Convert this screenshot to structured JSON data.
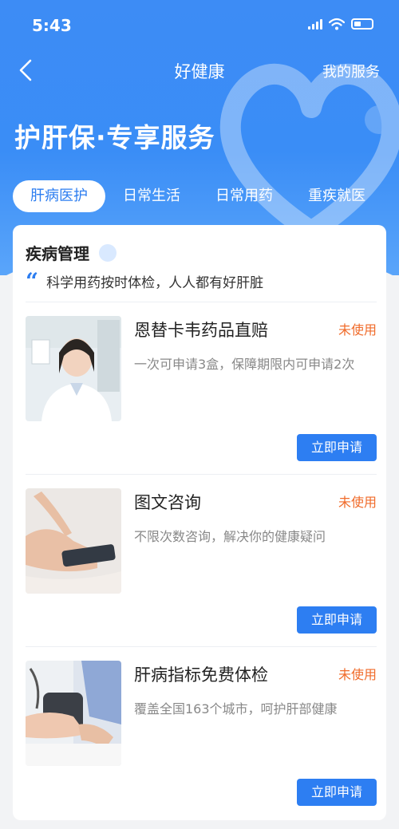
{
  "status_bar": {
    "time": "5:43"
  },
  "nav": {
    "title": "好健康",
    "right_link": "我的服务",
    "back_icon": "chevron-left-icon"
  },
  "hero": {
    "heading": "护肝保·专享服务"
  },
  "tabs": [
    {
      "label": "肝病医护",
      "active": true
    },
    {
      "label": "日常生活",
      "active": false
    },
    {
      "label": "日常用药",
      "active": false
    },
    {
      "label": "重疾就医",
      "active": false
    }
  ],
  "section": {
    "title": "疾病管理",
    "quote": "科学用药按时体检，人人都有好肝脏",
    "quote_icon": "quote-icon"
  },
  "items": [
    {
      "title": "恩替卡韦药品直赔",
      "status": "未使用",
      "desc": "一次可申请3盒，保障期限内可申请2次",
      "button": "立即申请"
    },
    {
      "title": "图文咨询",
      "status": "未使用",
      "desc": "不限次数咨询，解决你的健康疑问",
      "button": "立即申请"
    },
    {
      "title": "肝病指标免费体检",
      "status": "未使用",
      "desc": "覆盖全国163个城市，呵护肝部健康",
      "button": "立即申请"
    }
  ],
  "colors": {
    "primary": "#2d7ef2",
    "status_orange": "#f06b2a",
    "hero_blue": "#3d8cf5"
  }
}
